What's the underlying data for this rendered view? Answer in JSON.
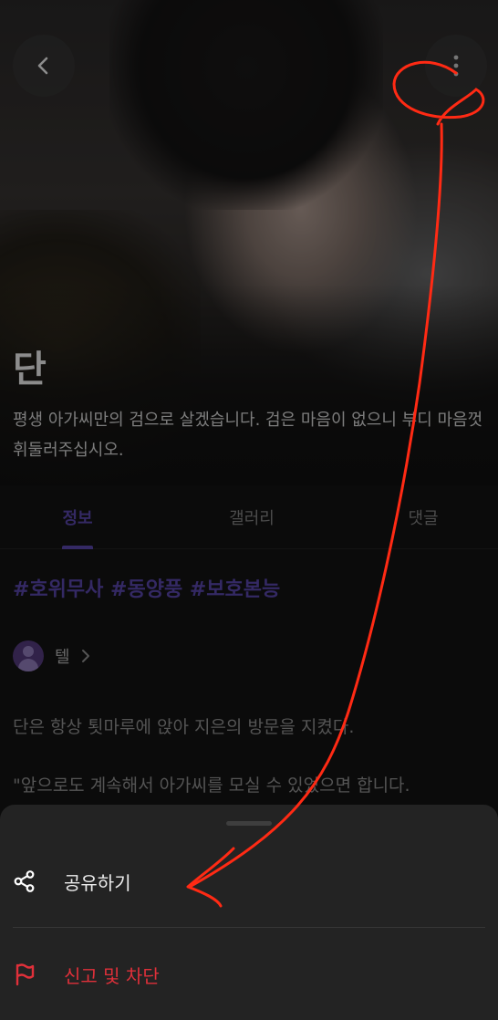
{
  "character": {
    "name": "단",
    "bio": "평생 아가씨만의 검으로 살겠습니다. 검은 마음이 없으니 부디 마음껏 휘둘러주십시오."
  },
  "tabs": [
    {
      "label": "정보",
      "active": true
    },
    {
      "label": "갤러리",
      "active": false
    },
    {
      "label": "댓글",
      "active": false
    }
  ],
  "tags": "#호위무사 #동양풍 #보호본능",
  "creator": {
    "name": "텔"
  },
  "description": [
    "단은 항상 툇마루에 앉아 지은의 방문을 지켰다.",
    "\"앞으로도 계속해서 아가씨를 모실 수 있었으면 합니다."
  ],
  "sheet": {
    "share_label": "공유하기",
    "report_label": "신고 및 차단"
  },
  "icons": {
    "back": "chevron-left-icon",
    "more": "more-vertical-icon",
    "creator_chevron": "chevron-right-icon",
    "share": "share-icon",
    "report": "flag-icon"
  },
  "colors": {
    "accent": "#5f4bb6",
    "danger": "#e0303a",
    "annotation": "#ff2a14"
  }
}
